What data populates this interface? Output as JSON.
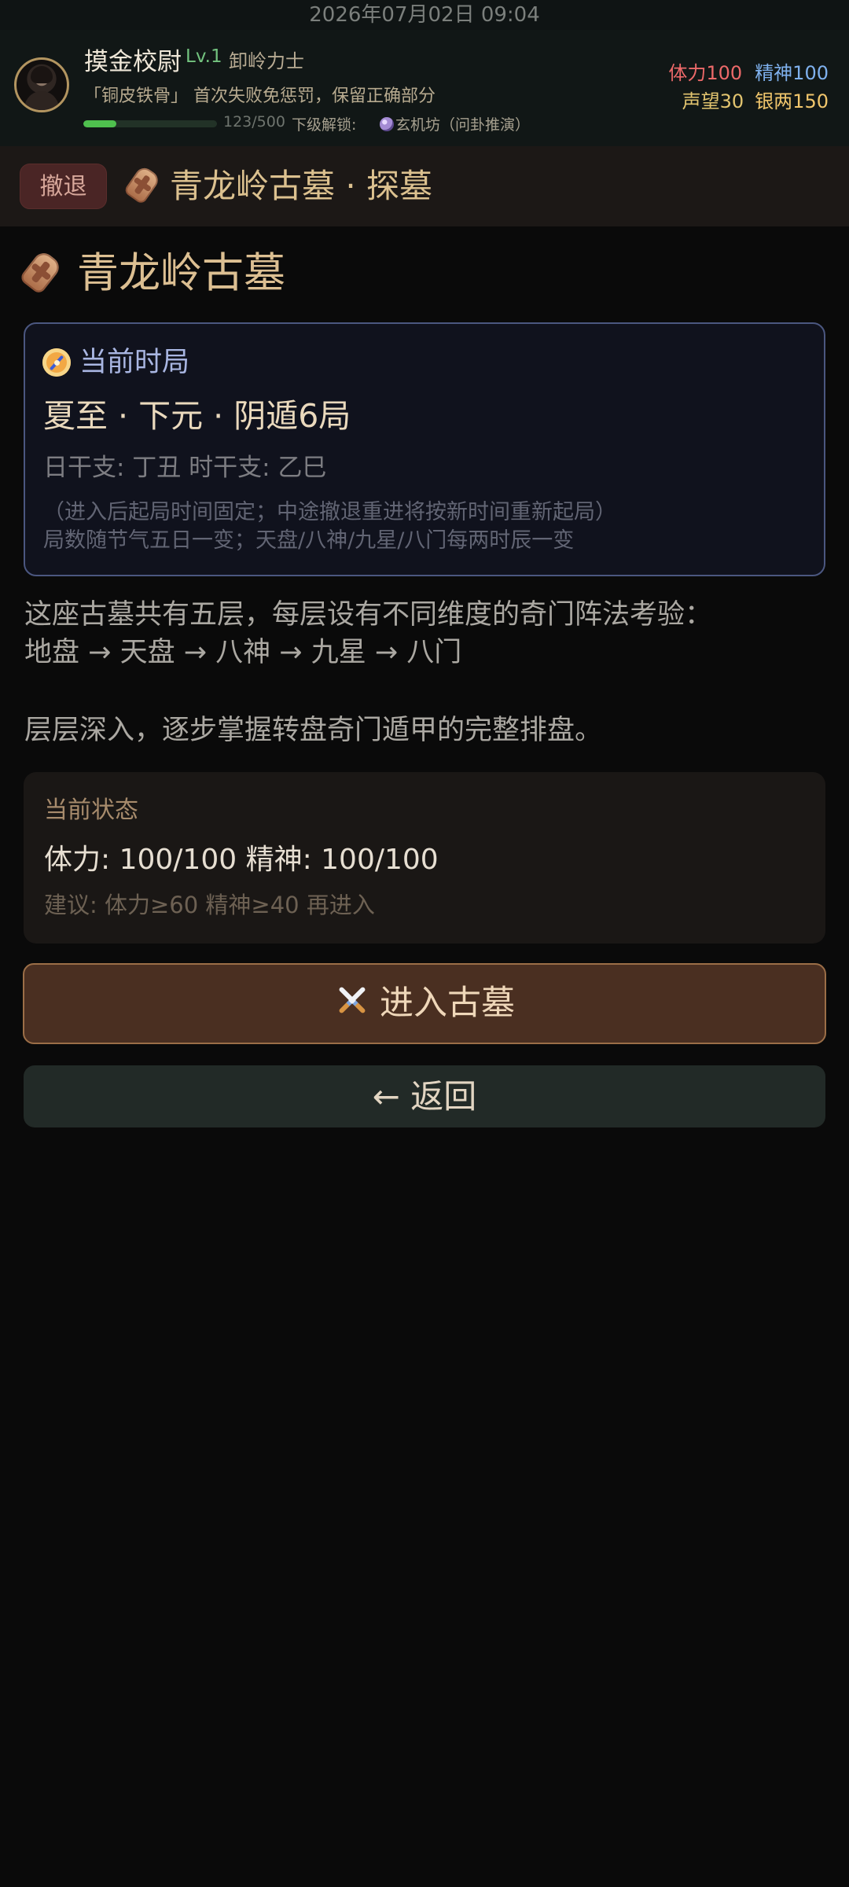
{
  "status_bar": {
    "datetime": "2026年07月02日 09:04"
  },
  "player": {
    "name": "摸金校尉",
    "level": "Lv.1",
    "class": "卸岭力士",
    "perk": "「铜皮铁骨」 首次失败免惩罚，保留正确部分",
    "xp_text": "123/500",
    "xp_progress": 0.246,
    "unlock_label": "下级解锁:",
    "unlock_value": "玄机坊（问卦推演）",
    "stats": {
      "stamina": "体力100",
      "spirit": "精神100",
      "reputation": "声望30",
      "silver": "银两150"
    },
    "colors": {
      "level": "#73c37f",
      "xp": "#4fc04e",
      "stamina": "#ec6969",
      "spirit": "#7fb1ee",
      "reputation": "#e2c46f",
      "silver": "#f1c66c"
    }
  },
  "header": {
    "retreat_label": "撤退",
    "title": "青龙岭古墓 · 探墓",
    "title_icon": "coffin-icon"
  },
  "location": {
    "heading": "青龙岭古墓",
    "heading_icon": "coffin-icon"
  },
  "time_card": {
    "title": "当前时局",
    "icon": "compass-icon",
    "ju": "夏至 · 下元 · 阴遁6局",
    "ganzhi": "日干支: 丁丑  时干支: 乙巳",
    "note_fixed_time": "（进入后起局时间固定；中途撤退重进将按新时间重新起局）",
    "note_change": "局数随节气五日一变；天盘/八神/九星/八门每两时辰一变"
  },
  "description": {
    "line_one": "这座古墓共有五层，每层设有不同维度的奇门阵法考验：",
    "line_two": "地盘 → 天盘 → 八神 → 九星 → 八门",
    "line_three": "层层深入，逐步掌握转盘奇门遁甲的完整排盘。"
  },
  "status_card": {
    "label": "当前状态",
    "values": "体力: 100/100  精神: 100/100",
    "advice": "建议: 体力≥60 精神≥40 再进入"
  },
  "actions": {
    "enter_label": "进入古墓",
    "enter_icon": "crossed-swords-icon",
    "return_label": "← 返回"
  }
}
